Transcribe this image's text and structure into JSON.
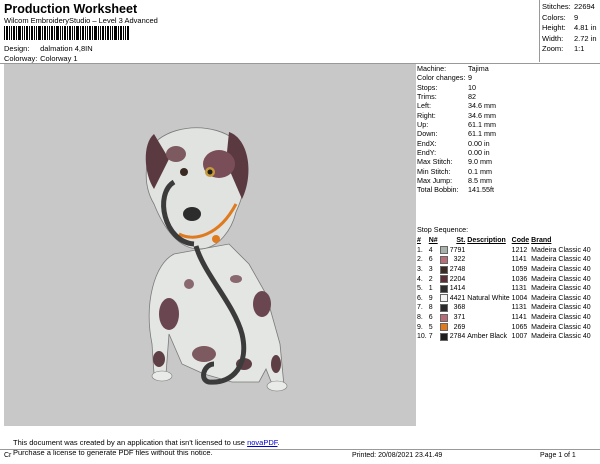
{
  "header": {
    "title": "Production Worksheet",
    "subtitle": "Wilcom EmbroideryStudio – Level 3 Advanced",
    "design_label": "Design:",
    "design_value": "dalmation 4,8IN",
    "colorway_label": "Colorway:",
    "colorway_value": "Colorway 1"
  },
  "top_stats": [
    {
      "k": "Stitches:",
      "v": "22694"
    },
    {
      "k": "Colors:",
      "v": "9"
    },
    {
      "k": "Height:",
      "v": "4.81 in"
    },
    {
      "k": "Width:",
      "v": "2.72 in"
    },
    {
      "k": "Zoom:",
      "v": "1:1"
    }
  ],
  "machine_info": [
    {
      "k": "Machine:",
      "v": "Tajima"
    },
    {
      "k": "Color changes:",
      "v": "9"
    },
    {
      "k": "Stops:",
      "v": "10"
    },
    {
      "k": "Trims:",
      "v": "82"
    },
    {
      "k": "Left:",
      "v": "34.6 mm"
    },
    {
      "k": "Right:",
      "v": "34.6 mm"
    },
    {
      "k": "Up:",
      "v": "61.1 mm"
    },
    {
      "k": "Down:",
      "v": "61.1 mm"
    },
    {
      "k": "EndX:",
      "v": "0.00 in"
    },
    {
      "k": "EndY:",
      "v": "0.00 in"
    },
    {
      "k": "Max Stitch:",
      "v": "9.0 mm"
    },
    {
      "k": "Min Stitch:",
      "v": "0.1 mm"
    },
    {
      "k": "Max Jump:",
      "v": "8.5 mm"
    },
    {
      "k": "Total Bobbin:",
      "v": "141.55ft"
    }
  ],
  "stop_sequence": {
    "title": "Stop Sequence:",
    "columns": [
      "#",
      "N#",
      "St.",
      "Description",
      "Code",
      "Brand"
    ],
    "rows": [
      {
        "n": "1.",
        "needle": "4",
        "color": "#a8b2aa",
        "st": "7791",
        "desc": "",
        "code": "1212",
        "brand": "Madeira Classic 40"
      },
      {
        "n": "2.",
        "needle": "6",
        "color": "#b76e78",
        "st": "322",
        "desc": "",
        "code": "1141",
        "brand": "Madeira Classic 40"
      },
      {
        "n": "3.",
        "needle": "3",
        "color": "#3a2a22",
        "st": "2748",
        "desc": "",
        "code": "1059",
        "brand": "Madeira Classic 40"
      },
      {
        "n": "4.",
        "needle": "2",
        "color": "#5a2e34",
        "st": "2204",
        "desc": "",
        "code": "1036",
        "brand": "Madeira Classic 40"
      },
      {
        "n": "5.",
        "needle": "1",
        "color": "#2c2c2c",
        "st": "1414",
        "desc": "",
        "code": "1131",
        "brand": "Madeira Classic 40"
      },
      {
        "n": "6.",
        "needle": "9",
        "color": "#f4f4f4",
        "st": "4421",
        "desc": "Natural White",
        "code": "1004",
        "brand": "Madeira Classic 40"
      },
      {
        "n": "7.",
        "needle": "8",
        "color": "#2a2a2a",
        "st": "368",
        "desc": "",
        "code": "1131",
        "brand": "Madeira Classic 40"
      },
      {
        "n": "8.",
        "needle": "6",
        "color": "#b76e78",
        "st": "371",
        "desc": "",
        "code": "1141",
        "brand": "Madeira Classic 40"
      },
      {
        "n": "9.",
        "needle": "5",
        "color": "#e07a1f",
        "st": "269",
        "desc": "",
        "code": "1065",
        "brand": "Madeira Classic 40"
      },
      {
        "n": "10.",
        "needle": "7",
        "color": "#1e1e1e",
        "st": "2784",
        "desc": "Amber Black",
        "code": "1007",
        "brand": "Madeira Classic 40"
      }
    ]
  },
  "notice": {
    "line1_pre": "This document was created by an application that isn't licensed to use ",
    "link": "novaPDF",
    "line1_post": ".",
    "line2": "Purchase a license to generate PDF files without this notice."
  },
  "footer": {
    "left": "Cr",
    "printed": "Printed: 20/08/2021 23.41.49",
    "page": "Page 1 of 1"
  }
}
